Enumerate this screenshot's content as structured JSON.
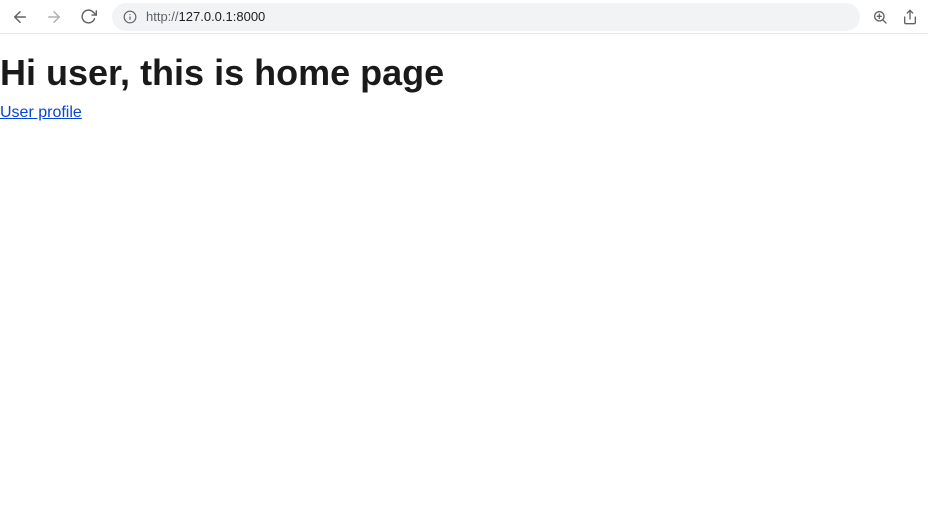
{
  "toolbar": {
    "url_proto": "http://",
    "url_rest": "127.0.0.1:8000"
  },
  "page": {
    "heading": "Hi user, this is home page",
    "link_text": "User profile"
  }
}
